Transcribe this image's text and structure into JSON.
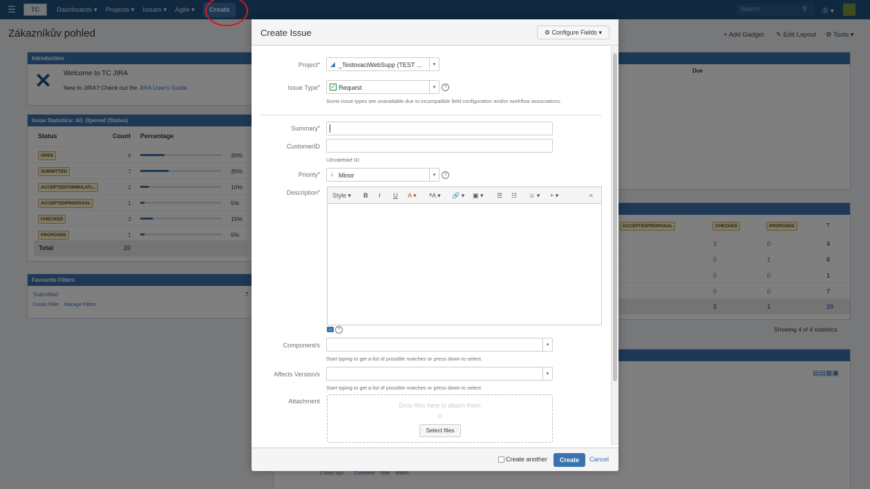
{
  "topnav": {
    "logo": "TC",
    "items": [
      "Dashboards ▾",
      "Projects ▾",
      "Issues ▾",
      "Agile ▾"
    ],
    "create": "Create",
    "search_placeholder": "Search",
    "help": "⓪ ▾"
  },
  "dashboard": {
    "title": "Zákazníkův pohled",
    "add_gadget": "+ Add Gadget",
    "edit_layout": "✎ Edit Layout",
    "tools": "⚙ Tools ▾",
    "intro": {
      "header": "Introduction",
      "welcome": "Welcome to TC JIRA",
      "new_text": "New to JIRA? Check out the",
      "guide_link": "JIRA User's Guide",
      "dot": "."
    },
    "stats": {
      "header": "Issue Statistics: All_Opened (Status)",
      "col_status": "Status",
      "col_count": "Count",
      "col_pct": "Percentage",
      "rows": [
        {
          "status": "OPEN",
          "count": "6",
          "pct": "30%",
          "frac": 0.3
        },
        {
          "status": "SUBMITTED",
          "count": "7",
          "pct": "35%",
          "frac": 0.35
        },
        {
          "status": "ACCEPTEDFORMULATI...",
          "count": "2",
          "pct": "10%",
          "frac": 0.1
        },
        {
          "status": "ACCEPTEDPROPOSAL",
          "count": "1",
          "pct": "5%",
          "frac": 0.05
        },
        {
          "status": "CHECKED",
          "count": "3",
          "pct": "15%",
          "frac": 0.15
        },
        {
          "status": "PROPOSED",
          "count": "1",
          "pct": "5%",
          "frac": 0.05
        }
      ],
      "total_label": "Total",
      "total_count": "20"
    },
    "filters": {
      "header": "Favourite Filters",
      "item": "Submitted",
      "item_count": "7",
      "create": "Create Filter",
      "manage": "Manage Filters"
    },
    "right": {
      "due": "Due",
      "cols": [
        "ACCEPTEDPROPOSAL",
        "CHECKED",
        "PROPOSED",
        "T"
      ],
      "rows": [
        [
          "3",
          "0",
          "4"
        ],
        [
          "0",
          "1",
          "8"
        ],
        [
          "0",
          "0",
          "1"
        ],
        [
          "0",
          "0",
          "7"
        ]
      ],
      "totals": [
        "3",
        "1",
        "20"
      ],
      "showing": "Showing 4 of 4 statistics.",
      "activity_meta": "2 days ago",
      "comment": "Comment",
      "vote": "Vote",
      "watch": "Watch"
    }
  },
  "dialog": {
    "title": "Create Issue",
    "configure": "⚙ Configure Fields ▾",
    "project_label": "Project",
    "project_value": "_TestovaciWebSupp (TEST ...",
    "issuetype_label": "Issue Type",
    "issuetype_value": "Request",
    "issuetype_hint": "Some issue types are unavailable due to incompatible field configuration and/or workflow associations.",
    "summary_label": "Summary",
    "customerid_label": "CustomerID",
    "customerid_hint": "Uživatelské ID",
    "priority_label": "Priority",
    "priority_value": "Minor",
    "description_label": "Description",
    "toolbar": {
      "style": "Style ▾",
      "bold": "B",
      "italic": "I",
      "underline": "U",
      "color": "A ▾",
      "size": "ᴬA ▾",
      "link": "🔗 ▾",
      "image": "▣ ▾",
      "bullets": "☰",
      "numbers": "☷",
      "emoji": "☺ ▾",
      "plus": "+ ▾",
      "collapse": "≈"
    },
    "components_label": "Component/s",
    "components_hint": "Start typing to get a list of possible matches or press down to select.",
    "versions_label": "Affects Version/s",
    "versions_hint": "Start typing to get a list of possible matches or press down to select.",
    "attachment_label": "Attachment",
    "drop_text": "Drop files here to attach them",
    "or": "or",
    "select_files": "Select files",
    "create_another": "Create another",
    "create_btn": "Create",
    "cancel": "Cancel"
  },
  "colors": {
    "nav": "#205081",
    "accent": "#3b73af",
    "required": "#d04437",
    "circle": "#d9181b"
  }
}
